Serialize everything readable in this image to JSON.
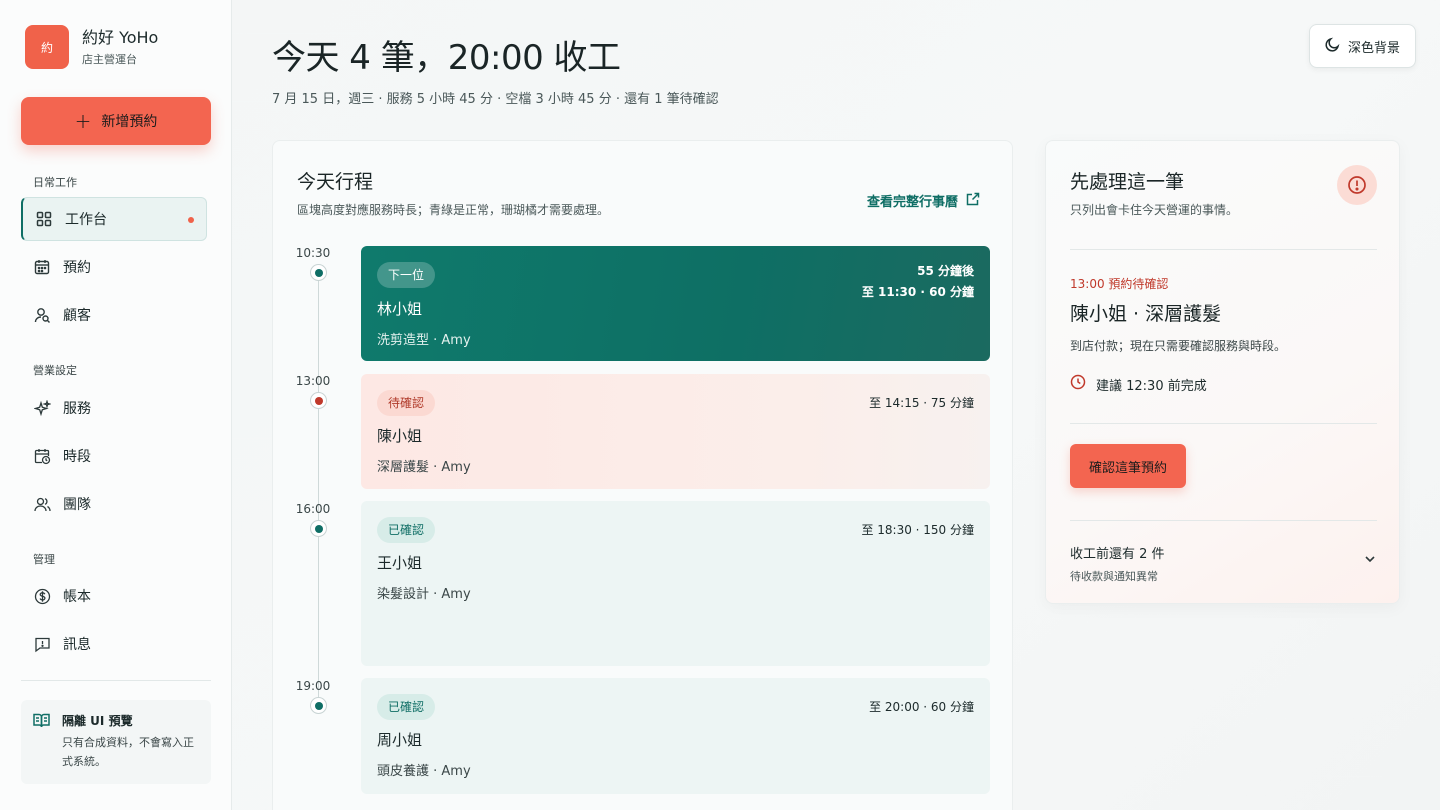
{
  "brand": {
    "logo_text": "約",
    "name": "約好 YoHo",
    "subtitle": "店主營運台"
  },
  "sidebar": {
    "new_button": "新增預約",
    "sections": [
      {
        "label": "日常工作"
      },
      {
        "label": "營業設定"
      },
      {
        "label": "管理"
      }
    ],
    "items": [
      {
        "label": "工作台",
        "icon": "dashboard-icon",
        "active": true,
        "has_dot": true
      },
      {
        "label": "預約",
        "icon": "calendar-icon"
      },
      {
        "label": "顧客",
        "icon": "user-search-icon"
      },
      {
        "label": "服務",
        "icon": "sparkle-icon"
      },
      {
        "label": "時段",
        "icon": "calendar-clock-icon"
      },
      {
        "label": "團隊",
        "icon": "users-icon"
      },
      {
        "label": "帳本",
        "icon": "dollar-icon"
      },
      {
        "label": "訊息",
        "icon": "message-alert-icon"
      }
    ],
    "preview": {
      "title": "隔離 UI 預覽",
      "desc": "只有合成資料，不會寫入正式系統。"
    }
  },
  "header": {
    "title": "今天 4 筆，20:00 收工",
    "subtitle": "7 月 15 日，週三 · 服務 5 小時 45 分 · 空檔 3 小時 45 分 · 還有 1 筆待確認",
    "theme_button": "深色背景"
  },
  "schedule": {
    "title": "今天行程",
    "desc": "區塊高度對應服務時長；青綠是正常，珊瑚橘才需要處理。",
    "link": "查看完整行事曆",
    "appointments": [
      {
        "time": "10:30",
        "badge": "下一位",
        "name": "林小姐",
        "service": "洗剪造型 · Amy",
        "right1": "55 分鐘後",
        "right2": "至 11:30 · 60 分鐘",
        "status": "next"
      },
      {
        "time": "13:00",
        "badge": "待確認",
        "name": "陳小姐",
        "service": "深層護髮 · Amy",
        "right1": "至 14:15 · 75 分鐘",
        "status": "pending"
      },
      {
        "time": "16:00",
        "badge": "已確認",
        "name": "王小姐",
        "service": "染髮設計 · Amy",
        "right1": "至 18:30 · 150 分鐘",
        "status": "confirmed"
      },
      {
        "time": "19:00",
        "badge": "已確認",
        "name": "周小姐",
        "service": "頭皮養護 · Amy",
        "right1": "至 20:00 · 60 分鐘",
        "status": "confirmed"
      }
    ]
  },
  "priority": {
    "title": "先處理這一筆",
    "desc": "只列出會卡住今天營運的事情。",
    "tag": "13:00 預約待確認",
    "name": "陳小姐 · 深層護髮",
    "note": "到店付款；現在只需要確認服務與時段。",
    "deadline": "建議 12:30 前完成",
    "button": "確認這筆預約",
    "more_title": "收工前還有 2 件",
    "more_sub": "待收款與通知異常"
  },
  "colors": {
    "accent": "#f36550",
    "teal": "#0f6e65",
    "alert": "#c0392b"
  }
}
